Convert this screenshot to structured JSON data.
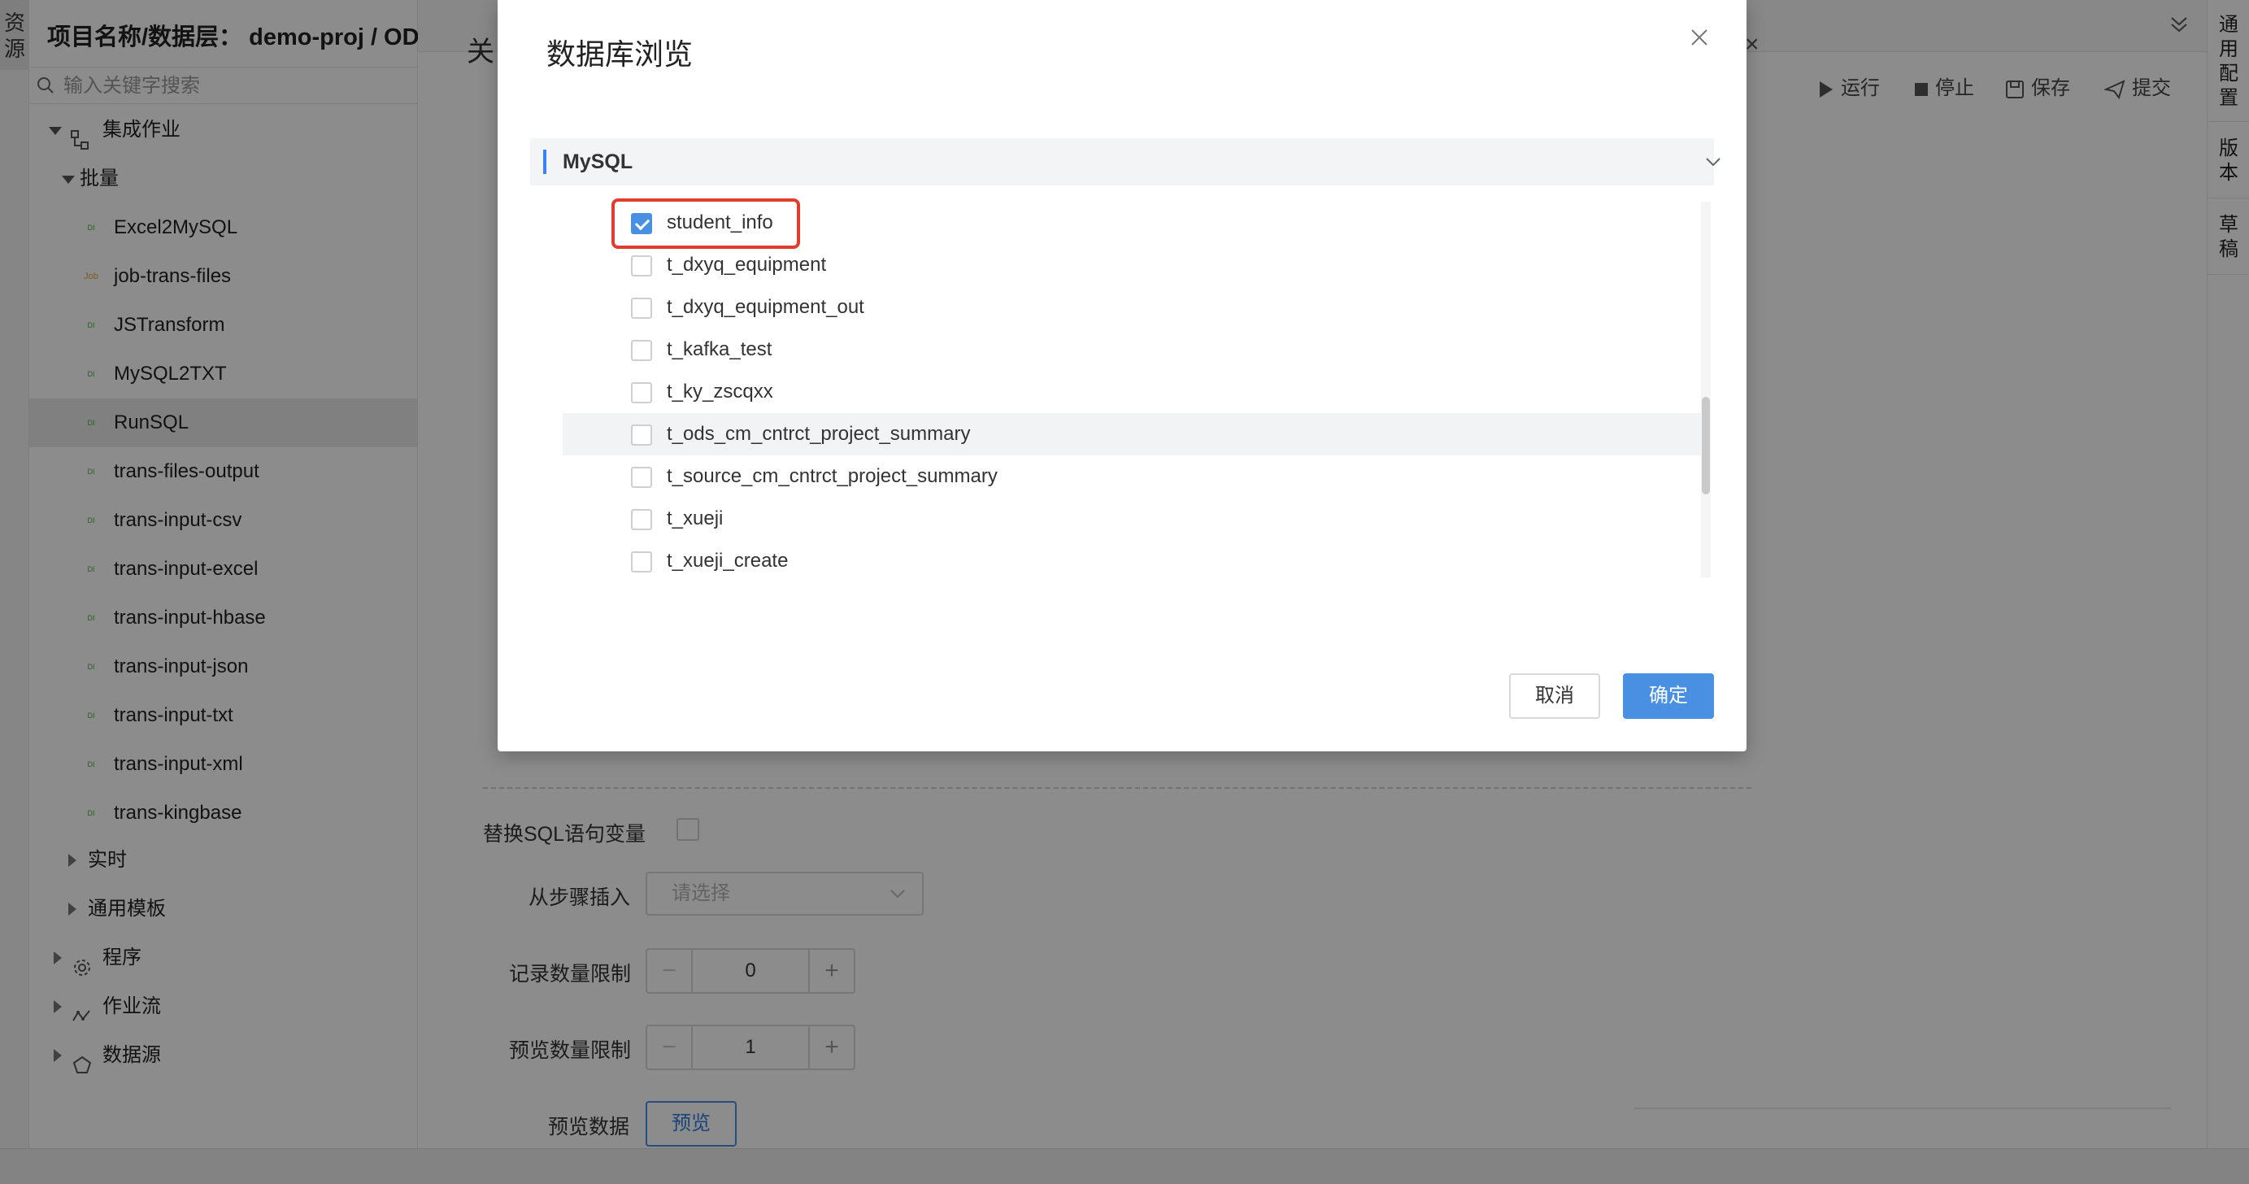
{
  "left_strip": {
    "resources_tab": "资\n源"
  },
  "sidebar": {
    "project_title": "项目名称/数据层： demo-proj / ODS",
    "search_placeholder": "输入关键字搜索",
    "tree": {
      "integration_jobs": "集成作业",
      "batch": "批量",
      "batch_items": [
        {
          "badge": "DI",
          "label": "Excel2MySQL"
        },
        {
          "badge": "Job",
          "label": "job-trans-files"
        },
        {
          "badge": "DI",
          "label": "JSTransform"
        },
        {
          "badge": "DI",
          "label": "MySQL2TXT"
        },
        {
          "badge": "DI",
          "label": "RunSQL"
        },
        {
          "badge": "DI",
          "label": "trans-files-output"
        },
        {
          "badge": "DI",
          "label": "trans-input-csv"
        },
        {
          "badge": "DI",
          "label": "trans-input-excel"
        },
        {
          "badge": "DI",
          "label": "trans-input-hbase"
        },
        {
          "badge": "DI",
          "label": "trans-input-json"
        },
        {
          "badge": "DI",
          "label": "trans-input-txt"
        },
        {
          "badge": "DI",
          "label": "trans-input-xml"
        },
        {
          "badge": "DI",
          "label": "trans-kingbase"
        }
      ],
      "realtime": "实时",
      "common_templates": "通用模板",
      "programs": "程序",
      "workflows": "作业流",
      "datasources": "数据源"
    }
  },
  "main": {
    "tab_text": "关",
    "toolbar": {
      "run": "运行",
      "stop": "停止",
      "save": "保存",
      "submit": "提交"
    },
    "form": {
      "replace_sql_vars": "替换SQL语句变量",
      "insert_from_step": "从步骤插入",
      "insert_placeholder": "请选择",
      "record_limit_label": "记录数量限制",
      "record_limit_value": "0",
      "preview_limit_label": "预览数量限制",
      "preview_limit_value": "1",
      "preview_data_label": "预览数据",
      "preview_button": "预览"
    }
  },
  "right_strip": {
    "common_config": "通\n用\n配\n置",
    "version": "版\n本",
    "draft": "草\n稿"
  },
  "modal": {
    "title": "数据库浏览",
    "section": "MySQL",
    "tables": [
      {
        "name": "student_info",
        "checked": true
      },
      {
        "name": "t_dxyq_equipment",
        "checked": false
      },
      {
        "name": "t_dxyq_equipment_out",
        "checked": false
      },
      {
        "name": "t_kafka_test",
        "checked": false
      },
      {
        "name": "t_ky_zscqxx",
        "checked": false
      },
      {
        "name": "t_ods_cm_cntrct_project_summary",
        "checked": false
      },
      {
        "name": "t_source_cm_cntrct_project_summary",
        "checked": false
      },
      {
        "name": "t_xueji",
        "checked": false
      },
      {
        "name": "t_xueji_create",
        "checked": false
      }
    ],
    "cancel": "取消",
    "ok": "确定"
  },
  "colors": {
    "accent": "#4a90e2",
    "highlight": "#e23d2c",
    "di_badge": "#4cae4c",
    "job_badge": "#e5a43b"
  }
}
